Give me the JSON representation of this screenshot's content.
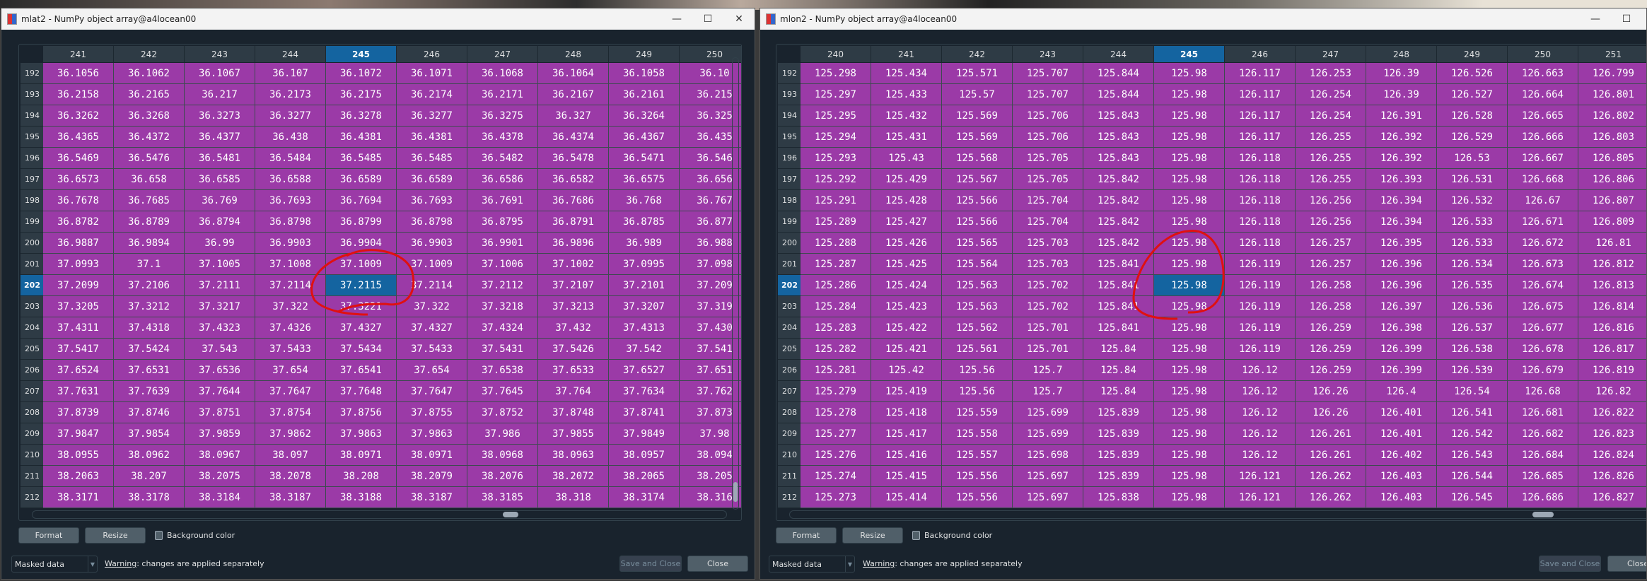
{
  "windows": [
    {
      "title": "mlat2 - NumPy object array@a4locean00",
      "columns": [
        "241",
        "242",
        "243",
        "244",
        "245",
        "246",
        "247",
        "248",
        "249",
        "250"
      ],
      "selected_column": "245",
      "selected_row": "202",
      "row_labels": [
        "192",
        "193",
        "194",
        "195",
        "196",
        "197",
        "198",
        "199",
        "200",
        "201",
        "202",
        "203",
        "204",
        "205",
        "206",
        "207",
        "208",
        "209",
        "210",
        "211",
        "212"
      ],
      "rows": [
        [
          "36.1056",
          "36.1062",
          "36.1067",
          "36.107",
          "36.1072",
          "36.1071",
          "36.1068",
          "36.1064",
          "36.1058",
          "36.10"
        ],
        [
          "36.2158",
          "36.2165",
          "36.217",
          "36.2173",
          "36.2175",
          "36.2174",
          "36.2171",
          "36.2167",
          "36.2161",
          "36.215"
        ],
        [
          "36.3262",
          "36.3268",
          "36.3273",
          "36.3277",
          "36.3278",
          "36.3277",
          "36.3275",
          "36.327",
          "36.3264",
          "36.325"
        ],
        [
          "36.4365",
          "36.4372",
          "36.4377",
          "36.438",
          "36.4381",
          "36.4381",
          "36.4378",
          "36.4374",
          "36.4367",
          "36.435"
        ],
        [
          "36.5469",
          "36.5476",
          "36.5481",
          "36.5484",
          "36.5485",
          "36.5485",
          "36.5482",
          "36.5478",
          "36.5471",
          "36.546"
        ],
        [
          "36.6573",
          "36.658",
          "36.6585",
          "36.6588",
          "36.6589",
          "36.6589",
          "36.6586",
          "36.6582",
          "36.6575",
          "36.656"
        ],
        [
          "36.7678",
          "36.7685",
          "36.769",
          "36.7693",
          "36.7694",
          "36.7693",
          "36.7691",
          "36.7686",
          "36.768",
          "36.767"
        ],
        [
          "36.8782",
          "36.8789",
          "36.8794",
          "36.8798",
          "36.8799",
          "36.8798",
          "36.8795",
          "36.8791",
          "36.8785",
          "36.877"
        ],
        [
          "36.9887",
          "36.9894",
          "36.99",
          "36.9903",
          "36.9904",
          "36.9903",
          "36.9901",
          "36.9896",
          "36.989",
          "36.988"
        ],
        [
          "37.0993",
          "37.1",
          "37.1005",
          "37.1008",
          "37.1009",
          "37.1009",
          "37.1006",
          "37.1002",
          "37.0995",
          "37.098"
        ],
        [
          "37.2099",
          "37.2106",
          "37.2111",
          "37.2114",
          "37.2115",
          "37.2114",
          "37.2112",
          "37.2107",
          "37.2101",
          "37.209"
        ],
        [
          "37.3205",
          "37.3212",
          "37.3217",
          "37.322",
          "37.3221",
          "37.322",
          "37.3218",
          "37.3213",
          "37.3207",
          "37.319"
        ],
        [
          "37.4311",
          "37.4318",
          "37.4323",
          "37.4326",
          "37.4327",
          "37.4327",
          "37.4324",
          "37.432",
          "37.4313",
          "37.430"
        ],
        [
          "37.5417",
          "37.5424",
          "37.543",
          "37.5433",
          "37.5434",
          "37.5433",
          "37.5431",
          "37.5426",
          "37.542",
          "37.541"
        ],
        [
          "37.6524",
          "37.6531",
          "37.6536",
          "37.654",
          "37.6541",
          "37.654",
          "37.6538",
          "37.6533",
          "37.6527",
          "37.651"
        ],
        [
          "37.7631",
          "37.7639",
          "37.7644",
          "37.7647",
          "37.7648",
          "37.7647",
          "37.7645",
          "37.764",
          "37.7634",
          "37.762"
        ],
        [
          "37.8739",
          "37.8746",
          "37.8751",
          "37.8754",
          "37.8756",
          "37.8755",
          "37.8752",
          "37.8748",
          "37.8741",
          "37.873"
        ],
        [
          "37.9847",
          "37.9854",
          "37.9859",
          "37.9862",
          "37.9863",
          "37.9863",
          "37.986",
          "37.9855",
          "37.9849",
          "37.98"
        ],
        [
          "38.0955",
          "38.0962",
          "38.0967",
          "38.097",
          "38.0971",
          "38.0971",
          "38.0968",
          "38.0963",
          "38.0957",
          "38.094"
        ],
        [
          "38.2063",
          "38.207",
          "38.2075",
          "38.2078",
          "38.208",
          "38.2079",
          "38.2076",
          "38.2072",
          "38.2065",
          "38.205"
        ],
        [
          "38.3171",
          "38.3178",
          "38.3184",
          "38.3187",
          "38.3188",
          "38.3187",
          "38.3185",
          "38.318",
          "38.3174",
          "38.316"
        ]
      ],
      "format_label": "Format",
      "resize_label": "Resize",
      "bg_color_label": "Background color",
      "bg_color_checked": false,
      "mode_select": "Masked data",
      "warning_prefix": "Warning",
      "warning_text": ": changes are applied separately",
      "save_close_label": "Save and Close",
      "close_label": "Close"
    },
    {
      "title": "mlon2 - NumPy object array@a4locean00",
      "columns": [
        "240",
        "241",
        "242",
        "243",
        "244",
        "245",
        "246",
        "247",
        "248",
        "249",
        "250",
        "251"
      ],
      "selected_column": "245",
      "selected_row": "202",
      "row_labels": [
        "192",
        "193",
        "194",
        "195",
        "196",
        "197",
        "198",
        "199",
        "200",
        "201",
        "202",
        "203",
        "204",
        "205",
        "206",
        "207",
        "208",
        "209",
        "210",
        "211",
        "212"
      ],
      "rows": [
        [
          "125.298",
          "125.434",
          "125.571",
          "125.707",
          "125.844",
          "125.98",
          "126.117",
          "126.253",
          "126.39",
          "126.526",
          "126.663",
          "126.799"
        ],
        [
          "125.297",
          "125.433",
          "125.57",
          "125.707",
          "125.844",
          "125.98",
          "126.117",
          "126.254",
          "126.39",
          "126.527",
          "126.664",
          "126.801"
        ],
        [
          "125.295",
          "125.432",
          "125.569",
          "125.706",
          "125.843",
          "125.98",
          "126.117",
          "126.254",
          "126.391",
          "126.528",
          "126.665",
          "126.802"
        ],
        [
          "125.294",
          "125.431",
          "125.569",
          "125.706",
          "125.843",
          "125.98",
          "126.117",
          "126.255",
          "126.392",
          "126.529",
          "126.666",
          "126.803"
        ],
        [
          "125.293",
          "125.43",
          "125.568",
          "125.705",
          "125.843",
          "125.98",
          "126.118",
          "126.255",
          "126.392",
          "126.53",
          "126.667",
          "126.805"
        ],
        [
          "125.292",
          "125.429",
          "125.567",
          "125.705",
          "125.842",
          "125.98",
          "126.118",
          "126.255",
          "126.393",
          "126.531",
          "126.668",
          "126.806"
        ],
        [
          "125.291",
          "125.428",
          "125.566",
          "125.704",
          "125.842",
          "125.98",
          "126.118",
          "126.256",
          "126.394",
          "126.532",
          "126.67",
          "126.807"
        ],
        [
          "125.289",
          "125.427",
          "125.566",
          "125.704",
          "125.842",
          "125.98",
          "126.118",
          "126.256",
          "126.394",
          "126.533",
          "126.671",
          "126.809"
        ],
        [
          "125.288",
          "125.426",
          "125.565",
          "125.703",
          "125.842",
          "125.98",
          "126.118",
          "126.257",
          "126.395",
          "126.533",
          "126.672",
          "126.81"
        ],
        [
          "125.287",
          "125.425",
          "125.564",
          "125.703",
          "125.841",
          "125.98",
          "126.119",
          "126.257",
          "126.396",
          "126.534",
          "126.673",
          "126.812"
        ],
        [
          "125.286",
          "125.424",
          "125.563",
          "125.702",
          "125.841",
          "125.98",
          "126.119",
          "126.258",
          "126.396",
          "126.535",
          "126.674",
          "126.813"
        ],
        [
          "125.284",
          "125.423",
          "125.563",
          "125.702",
          "125.841",
          "125.98",
          "126.119",
          "126.258",
          "126.397",
          "126.536",
          "126.675",
          "126.814"
        ],
        [
          "125.283",
          "125.422",
          "125.562",
          "125.701",
          "125.841",
          "125.98",
          "126.119",
          "126.259",
          "126.398",
          "126.537",
          "126.677",
          "126.816"
        ],
        [
          "125.282",
          "125.421",
          "125.561",
          "125.701",
          "125.84",
          "125.98",
          "126.119",
          "126.259",
          "126.399",
          "126.538",
          "126.678",
          "126.817"
        ],
        [
          "125.281",
          "125.42",
          "125.56",
          "125.7",
          "125.84",
          "125.98",
          "126.12",
          "126.259",
          "126.399",
          "126.539",
          "126.679",
          "126.819"
        ],
        [
          "125.279",
          "125.419",
          "125.56",
          "125.7",
          "125.84",
          "125.98",
          "126.12",
          "126.26",
          "126.4",
          "126.54",
          "126.68",
          "126.82"
        ],
        [
          "125.278",
          "125.418",
          "125.559",
          "125.699",
          "125.839",
          "125.98",
          "126.12",
          "126.26",
          "126.401",
          "126.541",
          "126.681",
          "126.822"
        ],
        [
          "125.277",
          "125.417",
          "125.558",
          "125.699",
          "125.839",
          "125.98",
          "126.12",
          "126.261",
          "126.401",
          "126.542",
          "126.682",
          "126.823"
        ],
        [
          "125.276",
          "125.416",
          "125.557",
          "125.698",
          "125.839",
          "125.98",
          "126.12",
          "126.261",
          "126.402",
          "126.543",
          "126.684",
          "126.824"
        ],
        [
          "125.274",
          "125.415",
          "125.556",
          "125.697",
          "125.839",
          "125.98",
          "126.121",
          "126.262",
          "126.403",
          "126.544",
          "126.685",
          "126.826"
        ],
        [
          "125.273",
          "125.414",
          "125.556",
          "125.697",
          "125.838",
          "125.98",
          "126.121",
          "126.262",
          "126.403",
          "126.545",
          "126.686",
          "126.827"
        ]
      ],
      "format_label": "Format",
      "resize_label": "Resize",
      "bg_color_label": "Background color",
      "bg_color_checked": false,
      "mode_select": "Masked data",
      "warning_prefix": "Warning",
      "warning_text": ": changes are applied separately",
      "save_close_label": "Save and Close",
      "close_label": "Close"
    }
  ],
  "colors": {
    "cell_background": "#9b3aa7",
    "selection": "#1464a0",
    "window_background": "#19232d",
    "annotation": "#e01010"
  },
  "icons": [
    "app-icon",
    "minimize-icon",
    "maximize-icon",
    "close-icon",
    "checkbox-icon",
    "dropdown-arrow-icon"
  ]
}
